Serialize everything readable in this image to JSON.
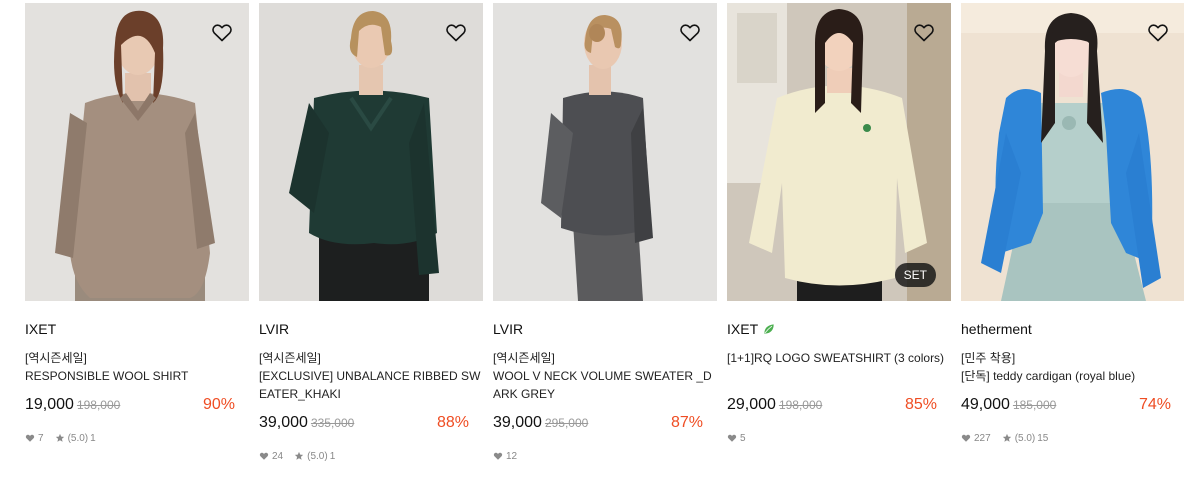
{
  "products": [
    {
      "brand": "IXET",
      "title_line1": "[역시즌세일]",
      "title_line2": "RESPONSIBLE WOOL SHIRT",
      "price": "19,000",
      "original_price": "198,000",
      "discount": "90%",
      "likes": "7",
      "rating": "(5.0)",
      "reviews": "1"
    },
    {
      "brand": "LVIR",
      "title_line1": "[역시즌세일]",
      "title_line2": "[EXCLUSIVE] UNBALANCE RIBBED SWEATER_KHAKI",
      "price": "39,000",
      "original_price": "335,000",
      "discount": "88%",
      "likes": "24",
      "rating": "(5.0)",
      "reviews": "1"
    },
    {
      "brand": "LVIR",
      "title_line1": "[역시즌세일]",
      "title_line2": "WOOL V NECK VOLUME SWEATER _DARK GREY",
      "price": "39,000",
      "original_price": "295,000",
      "discount": "87%",
      "likes": "12"
    },
    {
      "brand": "IXET",
      "title_line1": "[1+1]RQ LOGO SWEATSHIRT (3 colors)",
      "price": "29,000",
      "original_price": "198,000",
      "discount": "85%",
      "likes": "5",
      "badge": "SET"
    },
    {
      "brand": "hetherment",
      "title_line1": "[민주 착용]",
      "title_line2": "[단독] teddy cardigan (royal blue)",
      "price": "49,000",
      "original_price": "185,000",
      "discount": "74%",
      "likes": "227",
      "rating": "(5.0)",
      "reviews": "15"
    }
  ],
  "colors": {
    "discount": "#ef4d23",
    "muted": "#888888",
    "badge_bg": "#1a1a1a"
  },
  "icons": {
    "wishlist": "heart-outline-icon",
    "likes": "heart-filled-icon",
    "rating": "star-icon",
    "eco": "leaf-icon"
  }
}
